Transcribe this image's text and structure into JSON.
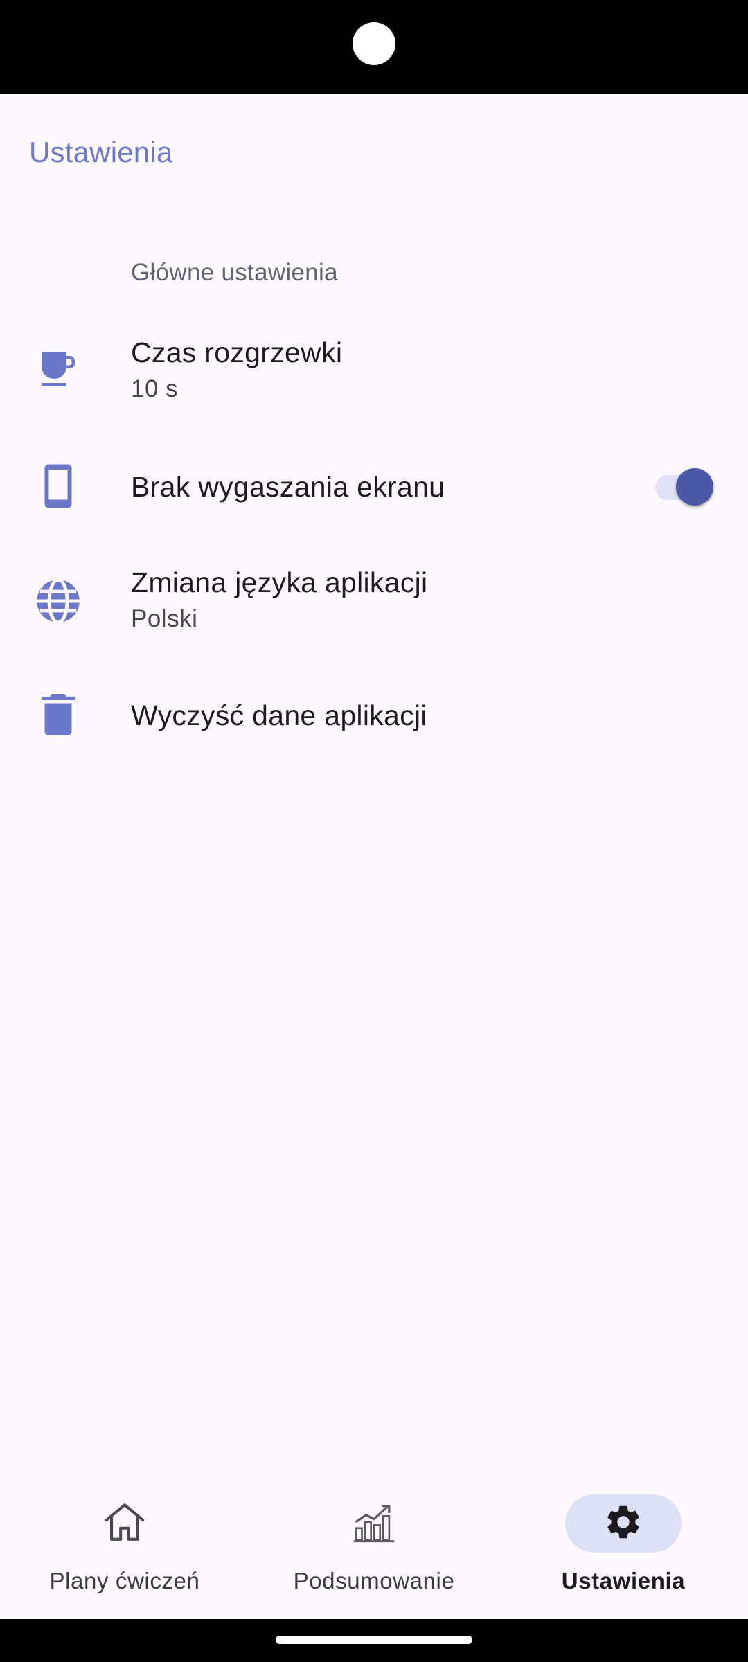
{
  "header": {
    "title": "Ustawienia"
  },
  "section": {
    "title": "Główne ustawienia"
  },
  "settings": [
    {
      "icon": "coffee-cup-icon",
      "title": "Czas rozgrzewki",
      "subtitle": "10 s"
    },
    {
      "icon": "phone-icon",
      "title": "Brak wygaszania ekranu",
      "toggle_on": true
    },
    {
      "icon": "globe-icon",
      "title": "Zmiana języka aplikacji",
      "subtitle": "Polski"
    },
    {
      "icon": "trash-icon",
      "title": "Wyczyść dane aplikacji"
    }
  ],
  "bottom_nav": {
    "items": [
      {
        "label": "Plany ćwiczeń",
        "icon": "home-icon",
        "active": false
      },
      {
        "label": "Podsumowanie",
        "icon": "chart-icon",
        "active": false
      },
      {
        "label": "Ustawienia",
        "icon": "gear-icon",
        "active": true
      }
    ]
  },
  "colors": {
    "accent": "#6b78c9",
    "toggle_thumb": "#4a58a6",
    "toggle_track": "#dfe1f6",
    "nav_active_pill": "#dde1f6",
    "background": "#fcf8fc"
  }
}
